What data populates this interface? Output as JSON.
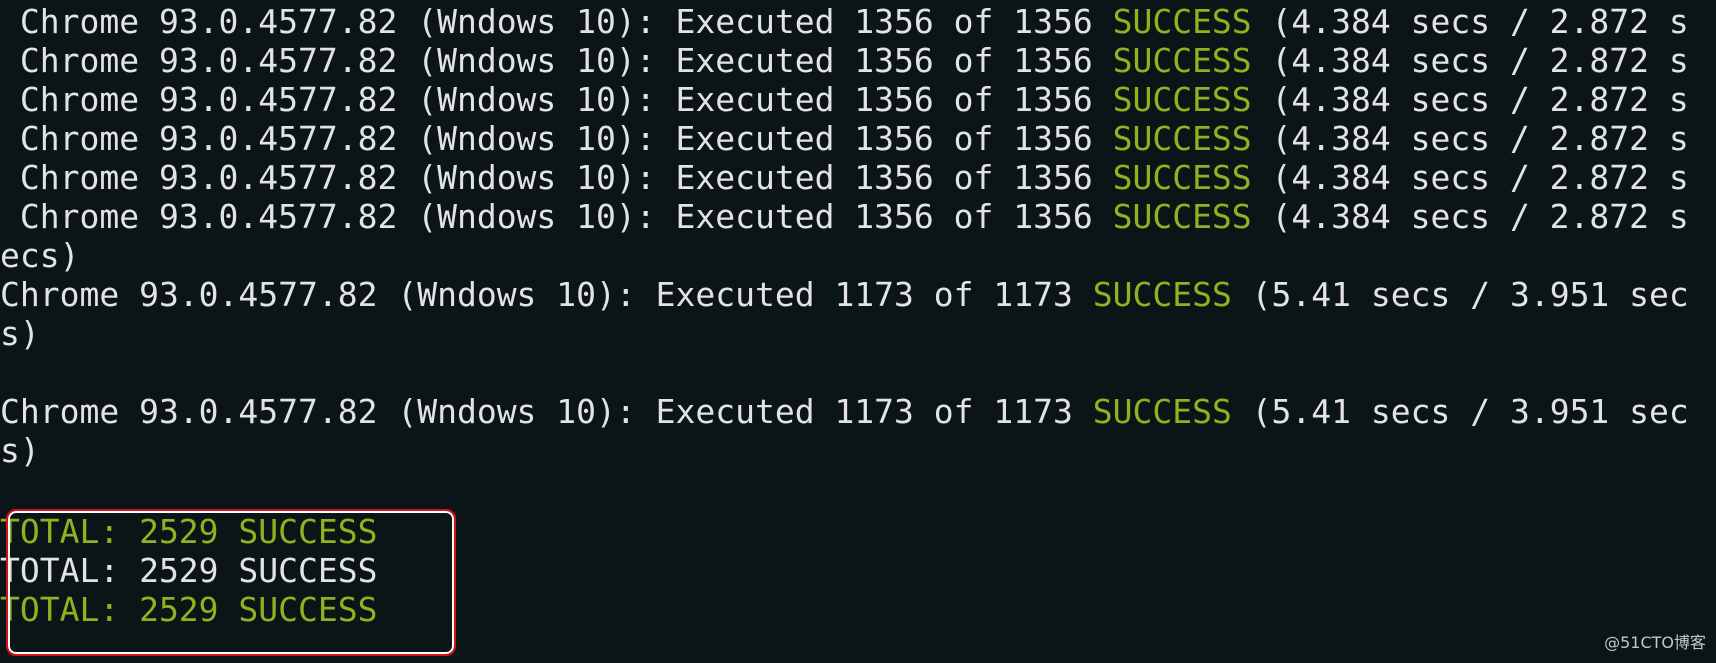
{
  "terminal": {
    "lines": [
      {
        "a": " Chrome 93.0.4577.82 (Wndows 10): Executed 1356 of 1356 ",
        "b": "SUCCESS",
        "c": " (4.384 secs / 2.872 s"
      },
      {
        "a": " Chrome 93.0.4577.82 (Wndows 10): Executed 1356 of 1356 ",
        "b": "SUCCESS",
        "c": " (4.384 secs / 2.872 s"
      },
      {
        "a": " Chrome 93.0.4577.82 (Wndows 10): Executed 1356 of 1356 ",
        "b": "SUCCESS",
        "c": " (4.384 secs / 2.872 s"
      },
      {
        "a": " Chrome 93.0.4577.82 (Wndows 10): Executed 1356 of 1356 ",
        "b": "SUCCESS",
        "c": " (4.384 secs / 2.872 s"
      },
      {
        "a": " Chrome 93.0.4577.82 (Wndows 10): Executed 1356 of 1356 ",
        "b": "SUCCESS",
        "c": " (4.384 secs / 2.872 s"
      },
      {
        "a": " Chrome 93.0.4577.82 (Wndows 10): Executed 1356 of 1356 ",
        "b": "SUCCESS",
        "c": " (4.384 secs / 2.872 s"
      },
      {
        "a": "ecs)",
        "b": "",
        "c": ""
      },
      {
        "a": "Chrome 93.0.4577.82 (Wndows 10): Executed 1173 of 1173 ",
        "b": "SUCCESS",
        "c": " (5.41 secs / 3.951 sec"
      },
      {
        "a": "s)",
        "b": "",
        "c": ""
      },
      {
        "a": "",
        "b": "",
        "c": ""
      },
      {
        "a": "Chrome 93.0.4577.82 (Wndows 10): Executed 1173 of 1173 ",
        "b": "SUCCESS",
        "c": " (5.41 secs / 3.951 sec"
      },
      {
        "a": "s)",
        "b": "",
        "c": ""
      }
    ],
    "totals": [
      {
        "text": "TOTAL: 2529 SUCCESS",
        "color": "green"
      },
      {
        "text": "TOTAL: 2529 SUCCESS",
        "color": "white"
      },
      {
        "text": "TOTAL: 2529 SUCCESS",
        "color": "green"
      }
    ]
  },
  "colors": {
    "background": "#0b1416",
    "text": "#e3e3e3",
    "success": "#8db31f",
    "highlight_border": "#d3111a"
  },
  "watermark": "@51CTO博客"
}
